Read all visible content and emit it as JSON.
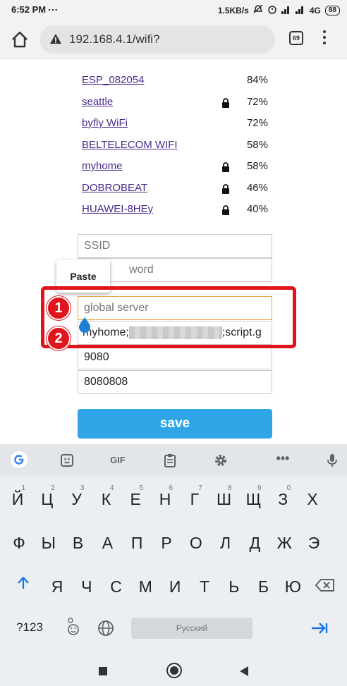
{
  "status": {
    "time": "6:52 PM",
    "dots": "...",
    "speed": "1.5KB/s",
    "network": "4G",
    "battery": "88"
  },
  "browser": {
    "url": "192.168.4.1/wifi?",
    "tab_count": "69"
  },
  "networks": [
    {
      "ssid": "ESP_082054",
      "locked": false,
      "signal": "84%"
    },
    {
      "ssid": "seattle",
      "locked": true,
      "signal": "72%"
    },
    {
      "ssid": "byfly WiFi",
      "locked": false,
      "signal": "72%"
    },
    {
      "ssid": "BELTELECOM WIFI",
      "locked": false,
      "signal": "58%"
    },
    {
      "ssid": "myhome",
      "locked": true,
      "signal": "58%"
    },
    {
      "ssid": "DOBROBEAT",
      "locked": true,
      "signal": "46%"
    },
    {
      "ssid": "HUAWEI-8HEy",
      "locked": true,
      "signal": "40%"
    }
  ],
  "form": {
    "ssid_placeholder": "SSID",
    "password_placeholder_visible": "word",
    "server_placeholder": "global server",
    "script_value_start": "myhome;",
    "script_value_end": ";script.g",
    "port_value": "9080",
    "id_value": "8080808",
    "save_label": "save"
  },
  "context_menu": {
    "paste_label": "Paste"
  },
  "annotations": {
    "badge1": "1",
    "badge2": "2",
    "box_color": "#e0141c"
  },
  "keyboard": {
    "row1": [
      {
        "key": "Й",
        "hint": "1"
      },
      {
        "key": "Ц",
        "hint": "2"
      },
      {
        "key": "У",
        "hint": "3"
      },
      {
        "key": "К",
        "hint": "4"
      },
      {
        "key": "Е",
        "hint": "5"
      },
      {
        "key": "Н",
        "hint": "6"
      },
      {
        "key": "Г",
        "hint": "7"
      },
      {
        "key": "Ш",
        "hint": "8"
      },
      {
        "key": "Щ",
        "hint": "9"
      },
      {
        "key": "З",
        "hint": "0"
      },
      {
        "key": "Х",
        "hint": ""
      }
    ],
    "row2": [
      "Ф",
      "Ы",
      "В",
      "А",
      "П",
      "Р",
      "О",
      "Л",
      "Д",
      "Ж",
      "Э"
    ],
    "row3": [
      "Я",
      "Ч",
      "С",
      "М",
      "И",
      "Т",
      "Ь",
      "Б",
      "Ю"
    ],
    "symbols_label": "?123",
    "space_label": "Русский",
    "gif_label": "GIF"
  },
  "colors": {
    "accent": "#2fa5e8",
    "link": "#4b2a8f",
    "focus_border": "#f0a040"
  }
}
